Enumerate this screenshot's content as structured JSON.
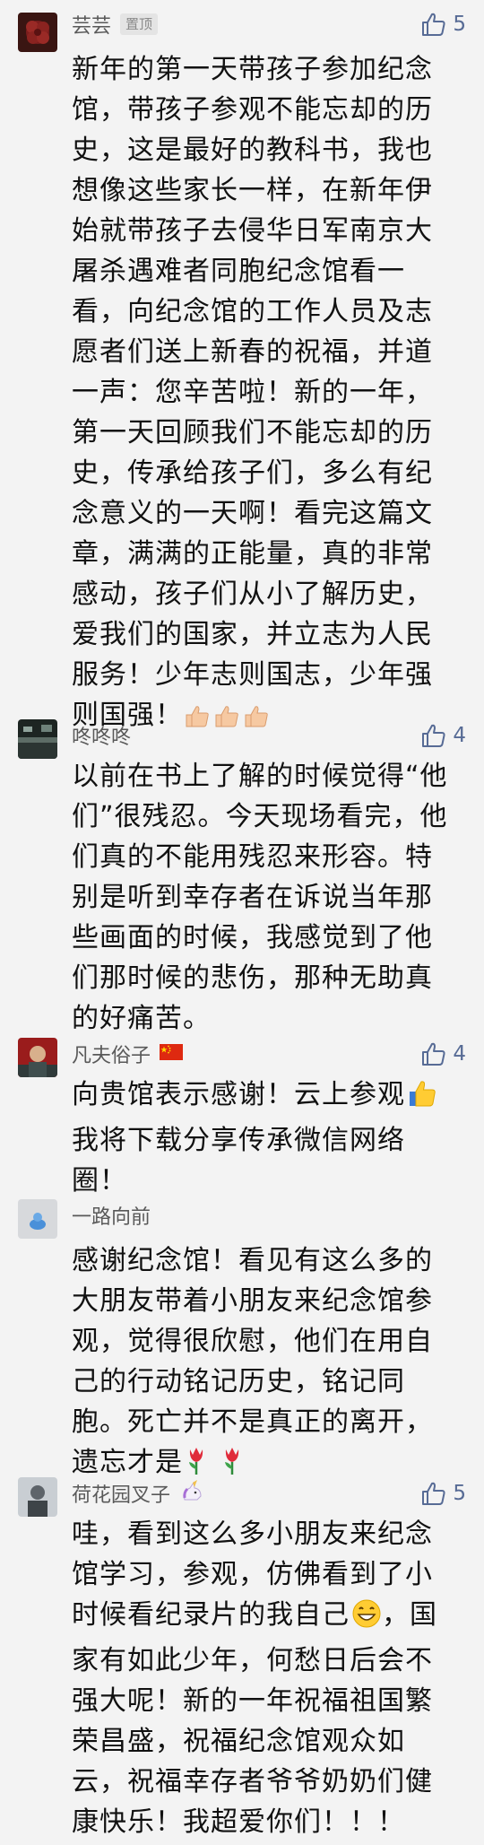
{
  "comments": [
    {
      "nickname": "芸芸",
      "badge": "置顶",
      "likes": "5",
      "lines": [
        "新年的第一天带孩子参加纪念",
        "馆，带孩子参观不能忘却的历",
        "史，这是最好的教科书，我也",
        "想像这些家长一样，在新年伊",
        "始就带孩子去侵华日军南京大",
        "屠杀遇难者同胞纪念馆看一",
        "看，向纪念馆的工作人员及志",
        "愿者们送上新春的祝福，并道",
        "一声：您辛苦啦！新的一年，",
        "第一天回顾我们不能忘却的历",
        "史，传承给孩子们，多么有纪",
        "念意义的一天啊！看完这篇文",
        "章，满满的正能量，真的非常",
        "感动，孩子们从小了解历史，",
        "爱我们的国家，并立志为人民",
        "服务！少年志则国志，少年强",
        "则国强！"
      ],
      "trailing_emoji": "thumbs-up-x3"
    },
    {
      "nickname": "咚咚咚",
      "likes": "4",
      "lines": [
        "以前在书上了解的时候觉得“他",
        "们”很残忍。今天现场看完，他",
        "们真的不能用残忍来形容。特",
        "别是听到幸存者在诉说当年那",
        "些画面的时候，我感觉到了他",
        "们那时候的悲伤，那种无助真",
        "的好痛苦。"
      ]
    },
    {
      "nickname": "凡夫俗子",
      "name_emoji": "china-flag",
      "likes": "4",
      "lines": [
        "向贵馆表示感谢！云上参观",
        "我将下载分享传承微信网络",
        "圈！"
      ],
      "line1_emoji": "thumbs-up"
    },
    {
      "nickname": "一路向前",
      "lines": [
        "感谢纪念馆！看见有这么多的",
        "大朋友带着小朋友来纪念馆参",
        "观，觉得很欣慰，他们在用自",
        "己的行动铭记历史，铭记同",
        "胞。死亡并不是真正的离开，",
        "遗忘才是"
      ],
      "trailing_emoji": "tulip-x2"
    },
    {
      "nickname": "荷花园叉子",
      "name_emoji": "unicorn",
      "likes": "5",
      "lines": [
        "哇，看到这么多小朋友来纪念",
        "馆学习，参观，仿佛看到了小",
        "时候看纪录片的我自己",
        "家有如此少年，何愁日后会不",
        "强大呢！新的一年祝福祖国繁",
        "荣昌盛，祝福纪念馆观众如",
        "云，祝福幸存者爷爷奶奶们健",
        "康快乐！我超爱你们！！！"
      ],
      "line3_emoji": "grinning-face",
      "line3_suffix": "，国"
    }
  ],
  "colors": {
    "like_blue": "#576b95",
    "nickname_gray": "#595959",
    "background": "#f3f3f3"
  },
  "icons": [
    "thumbs-up-outline-icon"
  ]
}
